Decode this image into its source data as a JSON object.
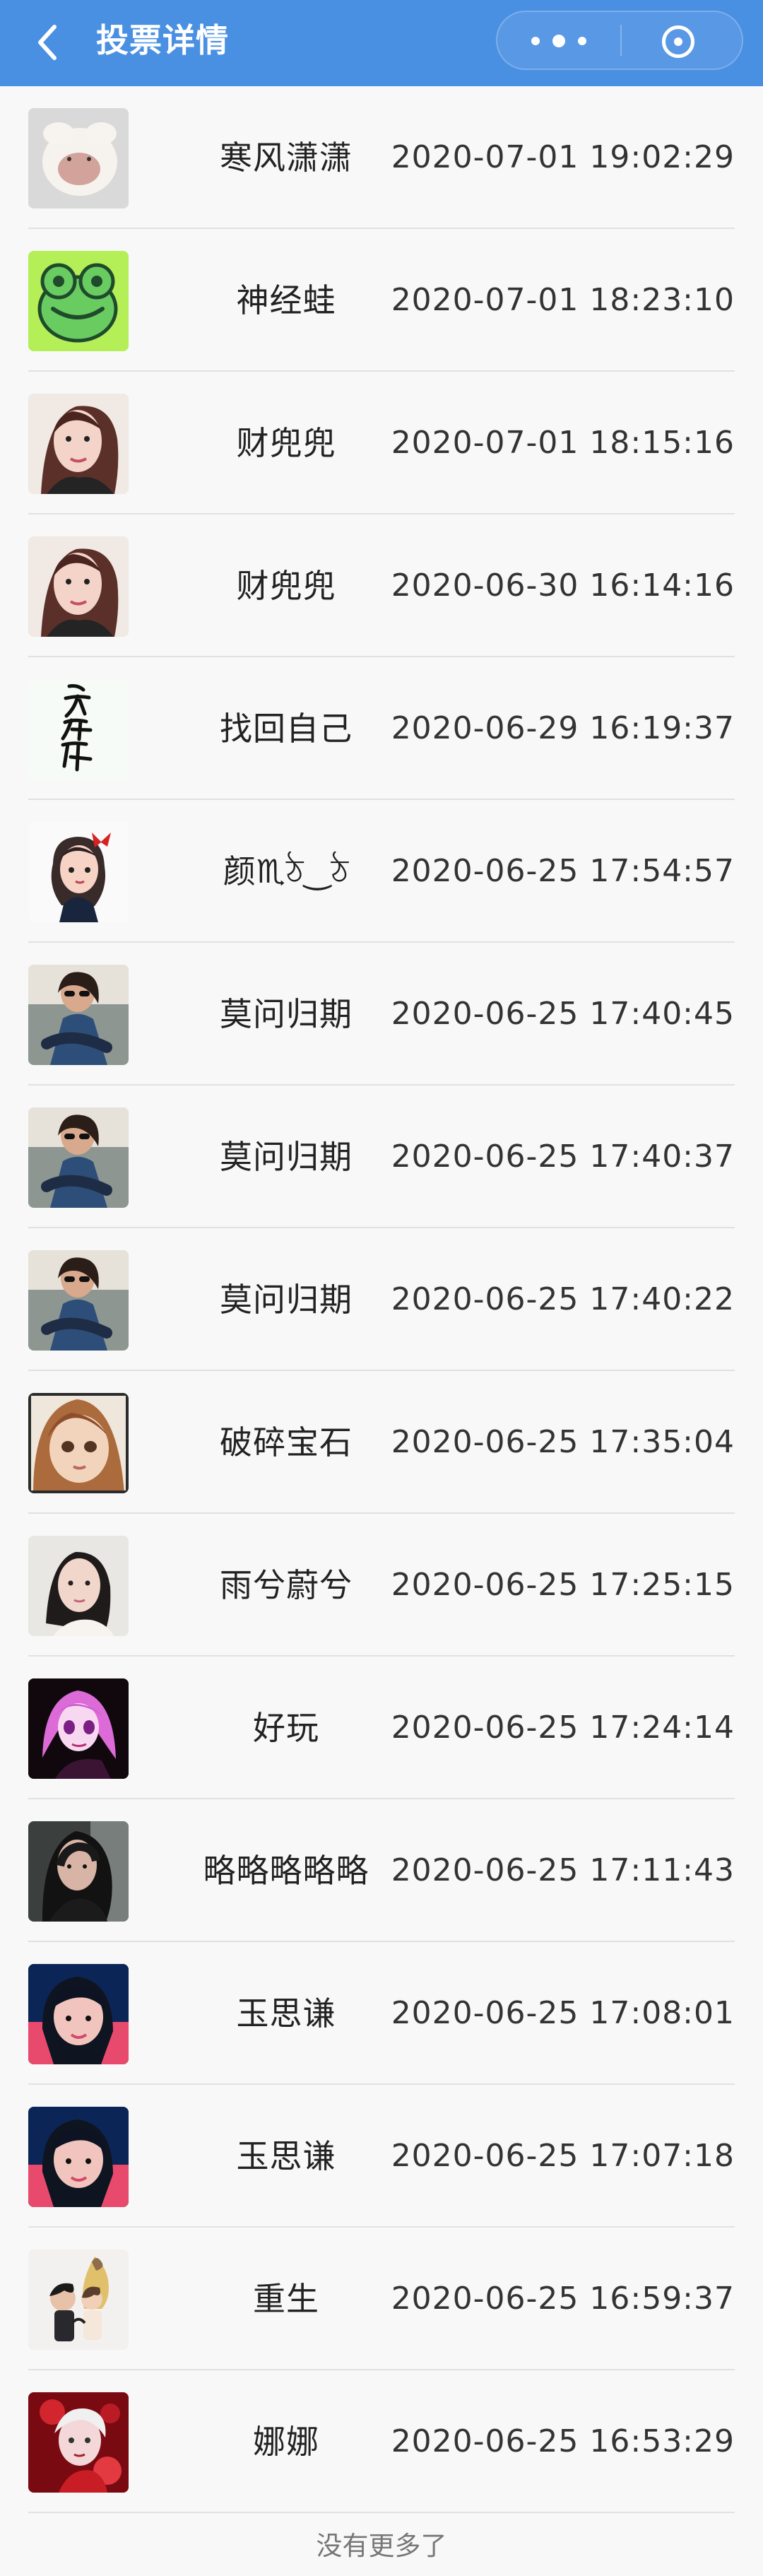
{
  "nav": {
    "title": "投票详情",
    "background_color": "#4a90e2",
    "back_icon": "chevron-left-icon",
    "more_icon": "more-dots-icon",
    "close_icon": "target-icon"
  },
  "votes": [
    {
      "nickname": "寒风潇潇",
      "time": "2020-07-01 19:02:29",
      "avatar_style": "white-lamb-plush"
    },
    {
      "nickname": "神经蛙",
      "time": "2020-07-01 18:23:10",
      "avatar_style": "green-frog-cartoon"
    },
    {
      "nickname": "财兜兜",
      "time": "2020-07-01 18:15:16",
      "avatar_style": "woman-long-hair-selfie"
    },
    {
      "nickname": "财兜兜",
      "time": "2020-06-30 16:14:16",
      "avatar_style": "woman-long-hair-selfie"
    },
    {
      "nickname": "找回自己",
      "time": "2020-06-29 16:19:37",
      "avatar_style": "calligraphy-characters"
    },
    {
      "nickname": "颜♏ঠ‿ঠ",
      "time": "2020-06-25 17:54:57",
      "avatar_style": "cartoon-girl-red-bow"
    },
    {
      "nickname": "莫问归期",
      "time": "2020-06-25 17:40:45",
      "avatar_style": "woman-sunglasses-sitting"
    },
    {
      "nickname": "莫问归期",
      "time": "2020-06-25 17:40:37",
      "avatar_style": "woman-sunglasses-sitting"
    },
    {
      "nickname": "莫问归期",
      "time": "2020-06-25 17:40:22",
      "avatar_style": "woman-sunglasses-sitting"
    },
    {
      "nickname": "破碎宝石",
      "time": "2020-06-25 17:35:04",
      "avatar_style": "anime-girl-orange-hair"
    },
    {
      "nickname": "雨兮蔚兮",
      "time": "2020-06-25 17:25:15",
      "avatar_style": "woman-light-portrait"
    },
    {
      "nickname": "好玩",
      "time": "2020-06-25 17:24:14",
      "avatar_style": "anime-pink-hair-dark"
    },
    {
      "nickname": "略略略略略",
      "time": "2020-06-25 17:11:43",
      "avatar_style": "woman-dark-long-hair"
    },
    {
      "nickname": "玉思谦",
      "time": "2020-06-25 17:08:01",
      "avatar_style": "girl-bangs-red-background"
    },
    {
      "nickname": "玉思谦",
      "time": "2020-06-25 17:07:18",
      "avatar_style": "girl-bangs-red-background"
    },
    {
      "nickname": "重生",
      "time": "2020-06-25 16:59:37",
      "avatar_style": "couple-illustration"
    },
    {
      "nickname": "娜娜",
      "time": "2020-06-25 16:53:29",
      "avatar_style": "red-flower-fantasy"
    }
  ],
  "footer": {
    "text": "没有更多了"
  }
}
